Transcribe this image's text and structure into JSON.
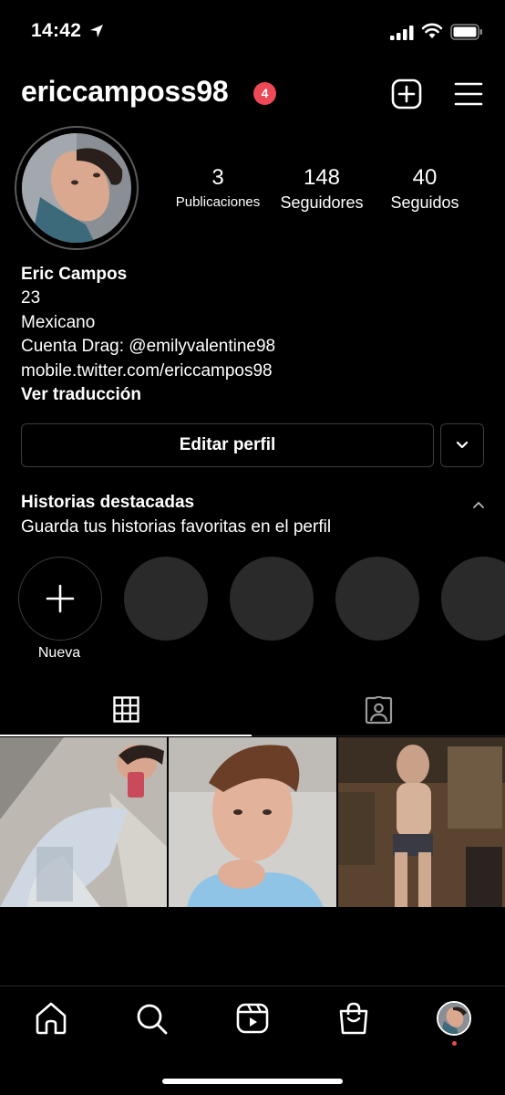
{
  "status_bar": {
    "time": "14:42"
  },
  "header": {
    "username": "ericcamposs98",
    "notification_count": "4"
  },
  "profile": {
    "stats": [
      {
        "value": "3",
        "label": "Publicaciones"
      },
      {
        "value": "148",
        "label": "Seguidores"
      },
      {
        "value": "40",
        "label": "Seguidos"
      }
    ],
    "bio": {
      "name": "Eric Campos",
      "lines": [
        "23",
        "Mexicano",
        "Cuenta Drag: @emilyvalentine98",
        "mobile.twitter.com/ericcampos98"
      ],
      "translate_link": "Ver traducción"
    },
    "edit_button": "Editar perfil"
  },
  "highlights": {
    "title": "Historias destacadas",
    "subtitle": "Guarda tus historias favoritas en el perfil",
    "new_label": "Nueva"
  },
  "tabs": [
    {
      "icon": "grid-icon",
      "active": true
    },
    {
      "icon": "tagged-icon",
      "active": false
    }
  ],
  "posts_count": 3,
  "bottom_nav": [
    "home-icon",
    "search-icon",
    "reels-icon",
    "shop-icon",
    "profile-avatar"
  ],
  "colors": {
    "badge": "#ed4956",
    "background": "#000000",
    "highlight_placeholder": "#2a2a2a"
  }
}
